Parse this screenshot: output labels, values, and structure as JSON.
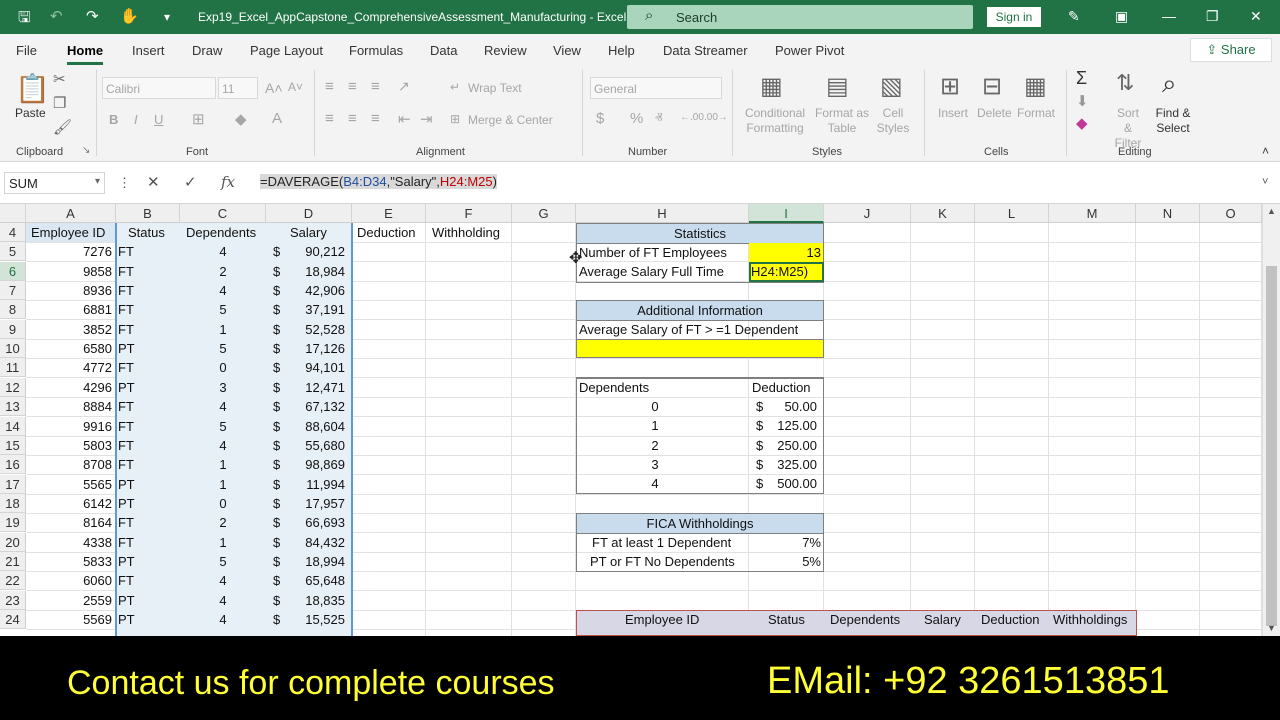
{
  "titlebar": {
    "title": "Exp19_Excel_AppCapstone_ComprehensiveAssessment_Manufacturing  -  Excel",
    "search_placeholder": "Search",
    "signin": "Sign in"
  },
  "menu": {
    "tabs": [
      "File",
      "Home",
      "Insert",
      "Draw",
      "Page Layout",
      "Formulas",
      "Data",
      "Review",
      "View",
      "Help",
      "Data Streamer",
      "Power Pivot"
    ],
    "share": "Share"
  },
  "ribbon": {
    "paste": "Paste",
    "clipboard": "Clipboard",
    "font_name": "Calibri",
    "font_size": "11",
    "font_label": "Font",
    "wrap_text": "Wrap Text",
    "merge_center": "Merge & Center",
    "alignment": "Alignment",
    "number_format": "General",
    "number": "Number",
    "conditional_formatting": "Conditional Formatting",
    "format_as_table": "Format as Table",
    "cell_styles": "Cell Styles",
    "styles": "Styles",
    "insert": "Insert",
    "delete": "Delete",
    "format": "Format",
    "cells": "Cells",
    "sort_filter": "Sort & Filter",
    "find_select": "Find & Select",
    "editing": "Editing"
  },
  "formula_bar": {
    "name_box": "SUM",
    "formula_prefix": "=DAVERAGE(",
    "formula_range1": "B4:D34",
    "formula_mid": ",\"Salary\",",
    "formula_range2": "H24:M25",
    "formula_suffix": ")"
  },
  "columns": [
    "A",
    "B",
    "C",
    "D",
    "E",
    "F",
    "G",
    "H",
    "I",
    "J",
    "K",
    "L",
    "M",
    "N",
    "O"
  ],
  "rows": [
    "4",
    "5",
    "6",
    "7",
    "8",
    "9",
    "10",
    "11",
    "12",
    "13",
    "14",
    "15",
    "16",
    "17",
    "18",
    "19",
    "20",
    "21",
    "22",
    "23",
    "24"
  ],
  "employee_table": {
    "headers": [
      "Employee ID",
      "Status",
      "Dependents",
      "Salary",
      "Deduction",
      "Withholding"
    ],
    "rows": [
      [
        "7276",
        "FT",
        "4",
        "90,212"
      ],
      [
        "9858",
        "FT",
        "2",
        "18,984"
      ],
      [
        "8936",
        "FT",
        "4",
        "42,906"
      ],
      [
        "6881",
        "FT",
        "5",
        "37,191"
      ],
      [
        "3852",
        "FT",
        "1",
        "52,528"
      ],
      [
        "6580",
        "PT",
        "5",
        "17,126"
      ],
      [
        "4772",
        "FT",
        "0",
        "94,101"
      ],
      [
        "4296",
        "PT",
        "3",
        "12,471"
      ],
      [
        "8884",
        "FT",
        "4",
        "67,132"
      ],
      [
        "9916",
        "FT",
        "5",
        "88,604"
      ],
      [
        "5803",
        "FT",
        "4",
        "55,680"
      ],
      [
        "8708",
        "FT",
        "1",
        "98,869"
      ],
      [
        "5565",
        "PT",
        "1",
        "11,994"
      ],
      [
        "6142",
        "PT",
        "0",
        "17,957"
      ],
      [
        "8164",
        "FT",
        "2",
        "66,693"
      ],
      [
        "4338",
        "FT",
        "1",
        "84,432"
      ],
      [
        "5833",
        "PT",
        "5",
        "18,994"
      ],
      [
        "6060",
        "FT",
        "4",
        "65,648"
      ],
      [
        "2559",
        "PT",
        "4",
        "18,835"
      ],
      [
        "5569",
        "PT",
        "4",
        "15,525"
      ]
    ],
    "currency": "$"
  },
  "statistics": {
    "title": "Statistics",
    "ft_label": "Number of FT Employees",
    "ft_value": "13",
    "avg_label": "Average Salary Full Time",
    "avg_value": "H24:M25)"
  },
  "additional": {
    "title": "Additional Information",
    "label": "Average Salary of FT > =1 Dependent"
  },
  "deduction_table": {
    "headers": [
      "Dependents",
      "Deduction"
    ],
    "rows": [
      [
        "0",
        "50.00"
      ],
      [
        "1",
        "125.00"
      ],
      [
        "2",
        "250.00"
      ],
      [
        "3",
        "325.00"
      ],
      [
        "4",
        "500.00"
      ]
    ],
    "currency": "$"
  },
  "fica": {
    "title": "FICA Withholdings",
    "rows": [
      [
        "FT at least 1 Dependent",
        "7%"
      ],
      [
        "PT or FT No Dependents",
        "5%"
      ]
    ]
  },
  "criteria_table": {
    "headers": [
      "Employee ID",
      "Status",
      "Dependents",
      "Salary",
      "Deduction",
      "Withholdings"
    ]
  },
  "banner": {
    "left": "Contact us for complete courses",
    "right": "EMail: +92 3261513851"
  }
}
